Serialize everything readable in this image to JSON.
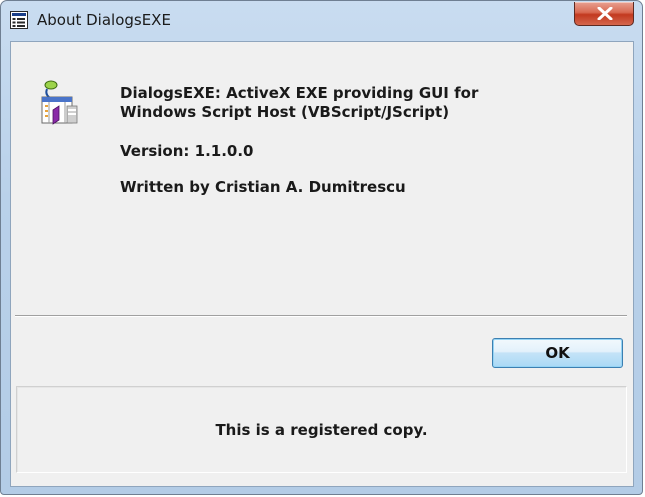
{
  "window": {
    "title": "About DialogsEXE",
    "icons": {
      "title": "about-window-icon",
      "close": "close-icon",
      "app": "dialogsexe-app-icon"
    }
  },
  "about": {
    "heading": "DialogsEXE: ActiveX EXE providing GUI for\nWindows Script Host (VBScript/JScript)",
    "version": "Version: 1.1.0.0",
    "author": "Written by Cristian A. Dumitrescu"
  },
  "buttons": {
    "ok_label": "OK"
  },
  "registration": {
    "text": "This is a registered copy."
  },
  "colors": {
    "titlebar": "#b9d1ea",
    "client_background": "#f0f0f0",
    "close_button": "#c2391f",
    "ok_button_border": "#3c7fb1"
  }
}
